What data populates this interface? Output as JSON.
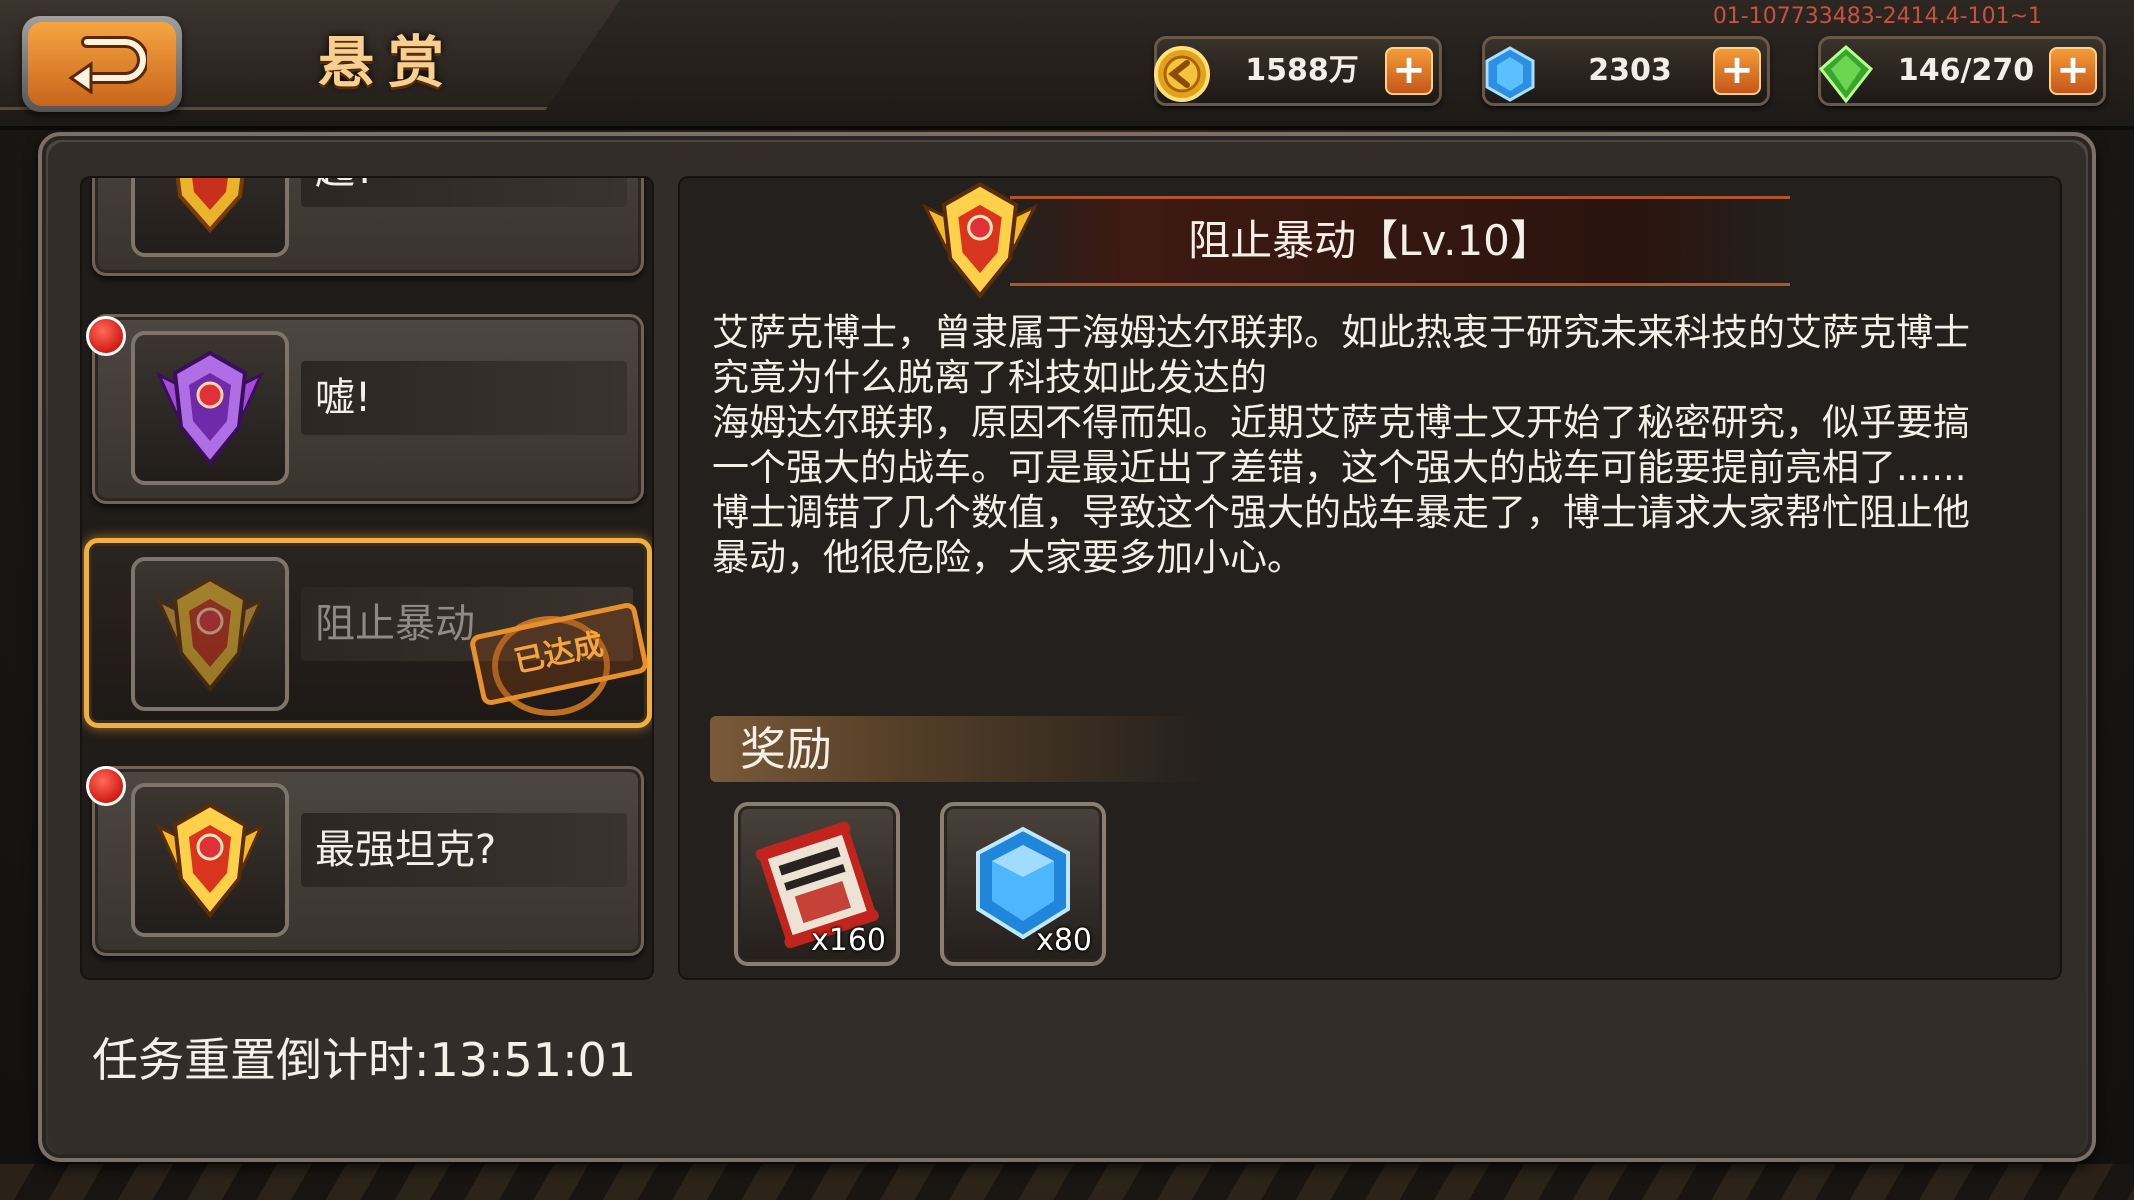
{
  "header": {
    "title": "悬赏",
    "build_id": "01-107733483-2414.4-101~1"
  },
  "resources": {
    "gold": "1588万",
    "gems": "2303",
    "stamina": "146/270"
  },
  "quests": [
    {
      "label": "起?",
      "completed": false,
      "has_notification": false
    },
    {
      "label": "嘘!",
      "completed": false,
      "has_notification": true
    },
    {
      "label": "阻止暴动",
      "completed": true,
      "has_notification": false,
      "stamp": "已达成"
    },
    {
      "label": "最强坦克?",
      "completed": false,
      "has_notification": true
    }
  ],
  "detail": {
    "title": "阻止暴动【Lv.10】",
    "description": [
      "艾萨克博士，曾隶属于海姆达尔联邦。如此热衷于研究未来科技的艾萨克博士究竟为什么脱离了科技如此发达的",
      "海姆达尔联邦，原因不得而知。近期艾萨克博士又开始了秘密研究，似乎要搞一个强大的战车。可是最近出了差错，这个强大的战车可能要提前亮相了......",
      "博士调错了几个数值，导致这个强大的战车暴走了，博士请求大家帮忙阻止他暴动，他很危险，大家要多加小心。"
    ],
    "reward_label": "奖励",
    "rewards": [
      {
        "name": "bounty-scroll",
        "count": "x160"
      },
      {
        "name": "blue-gem",
        "count": "x80"
      }
    ]
  },
  "footer": {
    "countdown_label": "任务重置倒计时:13:51:01"
  },
  "colors": {
    "accent": "#f0b040",
    "notification": "#d01c14",
    "stamp": "#e8902c"
  }
}
